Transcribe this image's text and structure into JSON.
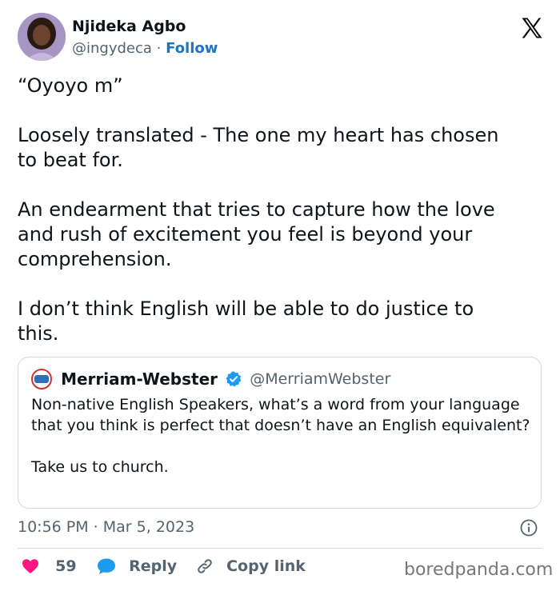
{
  "author": {
    "name": "Njideka Agbo",
    "handle": "@ingydeca",
    "separator": "·",
    "follow_label": "Follow"
  },
  "tweet": {
    "paragraphs": [
      "“Oyoyo m”",
      "Loosely translated - The one my heart has chosen\nto beat for.",
      "An endearment that tries to capture how the love\nand rush of excitement you feel is beyond your\ncomprehension.",
      "I don’t think English will be able to do justice to\nthis."
    ]
  },
  "quoted_tweet": {
    "name": "Merriam-Webster",
    "handle": "@MerriamWebster",
    "paragraphs": [
      "Non-native English Speakers, what’s a word from your language that you think is perfect that doesn’t have an English equivalent?",
      "Take us to church."
    ]
  },
  "timestamp": "10:56 PM · Mar 5, 2023",
  "actions": {
    "like_count": "59",
    "reply_label": "Reply",
    "copy_label": "Copy link"
  },
  "watermark": "boredpanda.com",
  "colors": {
    "follow": "#1d74c4",
    "like_heart": "#f91880",
    "reply_bubble": "#1d9bf0",
    "verified_badge": "#1d9bf0",
    "muted_text": "#536471"
  },
  "icons": {
    "brand": "x-logo-icon",
    "verified": "verified-badge-icon",
    "info": "info-icon",
    "like": "heart-icon",
    "reply": "reply-bubble-icon",
    "copy": "link-icon"
  }
}
